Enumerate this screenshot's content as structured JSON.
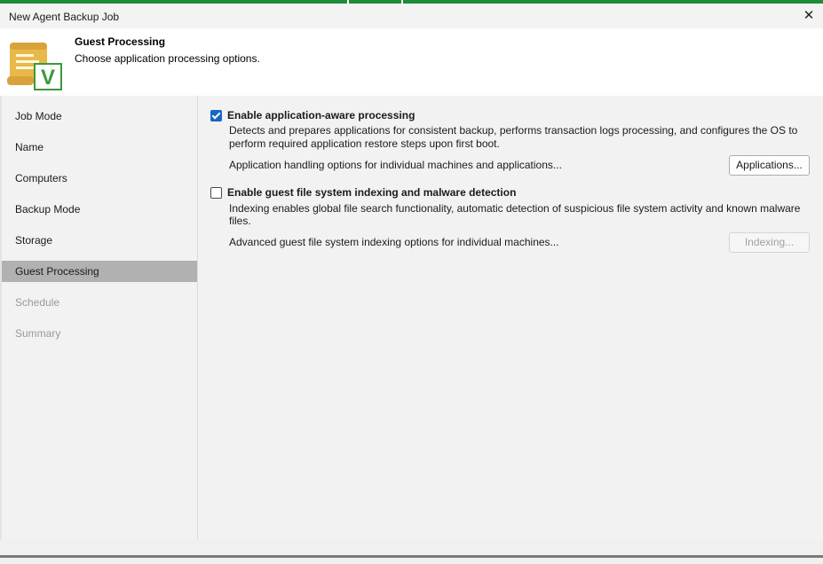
{
  "window": {
    "title": "New Agent Backup Job",
    "close_glyph": "✕"
  },
  "header": {
    "title": "Guest Processing",
    "subtitle": "Choose application processing options.",
    "icon": "scroll-check-icon",
    "logo_letter": "V"
  },
  "sidebar": {
    "items": [
      {
        "label": "Job Mode",
        "state": "normal"
      },
      {
        "label": "Name",
        "state": "normal"
      },
      {
        "label": "Computers",
        "state": "normal"
      },
      {
        "label": "Backup Mode",
        "state": "normal"
      },
      {
        "label": "Storage",
        "state": "normal"
      },
      {
        "label": "Guest Processing",
        "state": "active"
      },
      {
        "label": "Schedule",
        "state": "disabled"
      },
      {
        "label": "Summary",
        "state": "disabled"
      }
    ]
  },
  "main": {
    "app_aware": {
      "checked": true,
      "label": "Enable application-aware processing",
      "desc_line1": "Detects and prepares applications for consistent backup, performs transaction logs processing, and configures the OS to",
      "desc_line2": "perform required application restore steps upon first boot.",
      "options_text": "Application handling options for individual machines and applications...",
      "button_label": "Applications..."
    },
    "indexing": {
      "checked": false,
      "label": "Enable guest file system indexing and malware detection",
      "desc_line1": "Indexing enables global file search functionality, automatic detection of suspicious file system activity and known malware",
      "desc_line2": "files.",
      "options_text": "Advanced guest file system indexing options for individual machines...",
      "button_label": "Indexing..."
    }
  },
  "colors": {
    "accent_green": "#1e8a3a",
    "checkbox_blue": "#1666c4",
    "active_nav": "#b1b1b1"
  }
}
